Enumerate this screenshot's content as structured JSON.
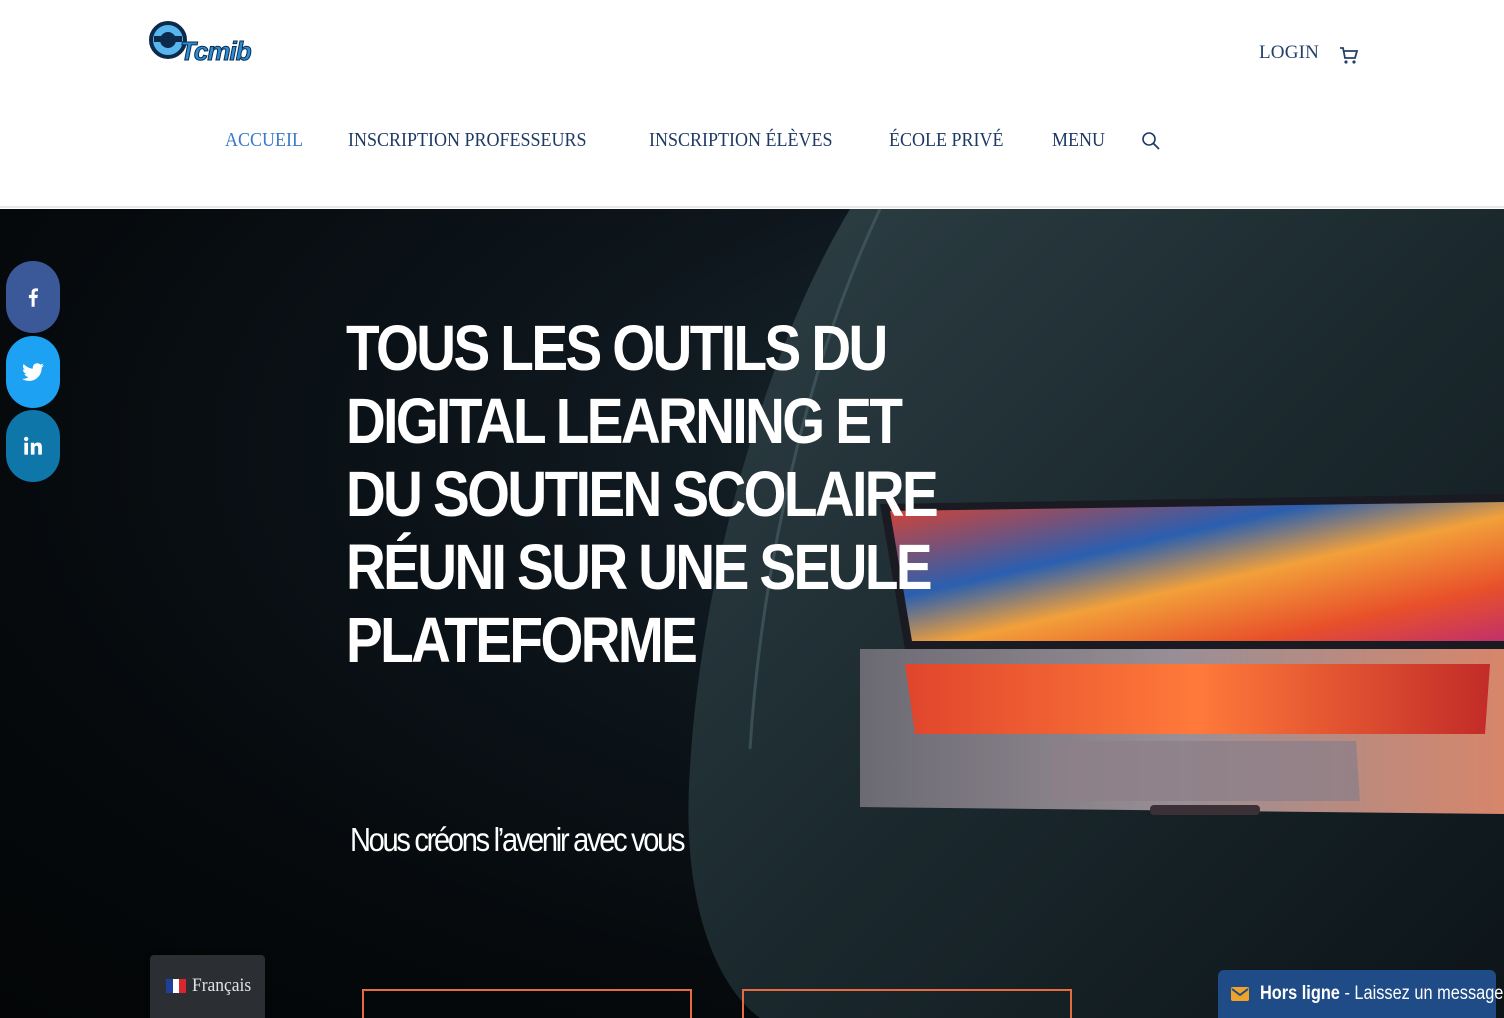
{
  "header": {
    "logo_text": "Tcmib",
    "login_label": "LOGIN",
    "cart_icon": "cart-icon",
    "nav": [
      {
        "label": "ACCUEIL",
        "active": true
      },
      {
        "label": "INSCRIPTION PROFESSEURS",
        "active": false
      },
      {
        "label": "INSCRIPTION ÉLÈVES",
        "active": false
      },
      {
        "label": "ÉCOLE PRIVÉ",
        "active": false
      },
      {
        "label": "MENU",
        "active": false
      }
    ],
    "search_icon": "search-icon"
  },
  "hero": {
    "title": "TOUS LES OUTILS DU DIGITAL LEARNING ET DU SOUTIEN SCOLAIRE RÉUNI SUR UNE SEULE PLATEFORME",
    "subtitle": "Nous créons l’avenir avec vous"
  },
  "social": [
    {
      "icon": "facebook-icon",
      "color": "#3b5998"
    },
    {
      "icon": "twitter-icon",
      "color": "#1da1f2"
    },
    {
      "icon": "linkedin-icon",
      "color": "#0e76a8"
    }
  ],
  "language": {
    "label": "Français",
    "flag_icon": "french-flag-icon"
  },
  "chat": {
    "status": "Hors ligne",
    "message": " - Laissez un message",
    "icon": "envelope-icon"
  },
  "colors": {
    "nav_text": "#1e3a64",
    "nav_active": "#3a79c9",
    "accent_orange": "#e86a3f",
    "chat_bg": "#1f4b87"
  }
}
